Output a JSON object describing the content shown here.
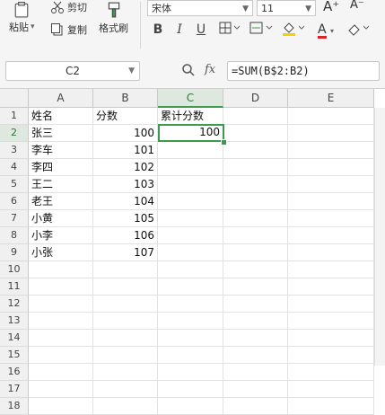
{
  "ribbon": {
    "paste_label": "粘贴",
    "paste_dropdown_glyph": "▾",
    "cut_label": "剪切",
    "copy_label": "复制",
    "format_painter_label": "格式刷",
    "font_name": "宋体",
    "font_size": "11",
    "increase_font_glyph": "A⁺",
    "decrease_font_glyph": "A⁻",
    "bold_glyph": "B",
    "italic_glyph": "I",
    "underline_glyph": "U",
    "font_color_glyph": "A",
    "accent_green": "#3c9a4f",
    "font_color": "#e02020",
    "fill_color": "#f5d000"
  },
  "formula_bar": {
    "name_box": "C2",
    "fx_label": "fx",
    "formula": "=SUM(B$2:B2)"
  },
  "sheet": {
    "columns": [
      "A",
      "B",
      "C",
      "D",
      "E"
    ],
    "rows": [
      "1",
      "2",
      "3",
      "4",
      "5",
      "6",
      "7",
      "8",
      "9",
      "10",
      "11",
      "12",
      "13",
      "14",
      "15",
      "16",
      "17",
      "18"
    ],
    "selected_cell": "C2",
    "cells": {
      "A1": "姓名",
      "B1": "分数",
      "C1": "累计分数",
      "A2": "张三",
      "B2": "100",
      "C2": "100",
      "A3": "李车",
      "B3": "101",
      "A4": "李四",
      "B4": "102",
      "A5": "王二",
      "B5": "103",
      "A6": "老王",
      "B6": "104",
      "A7": "小黄",
      "B7": "105",
      "A8": "小李",
      "B8": "106",
      "A9": "小张",
      "B9": "107"
    }
  }
}
